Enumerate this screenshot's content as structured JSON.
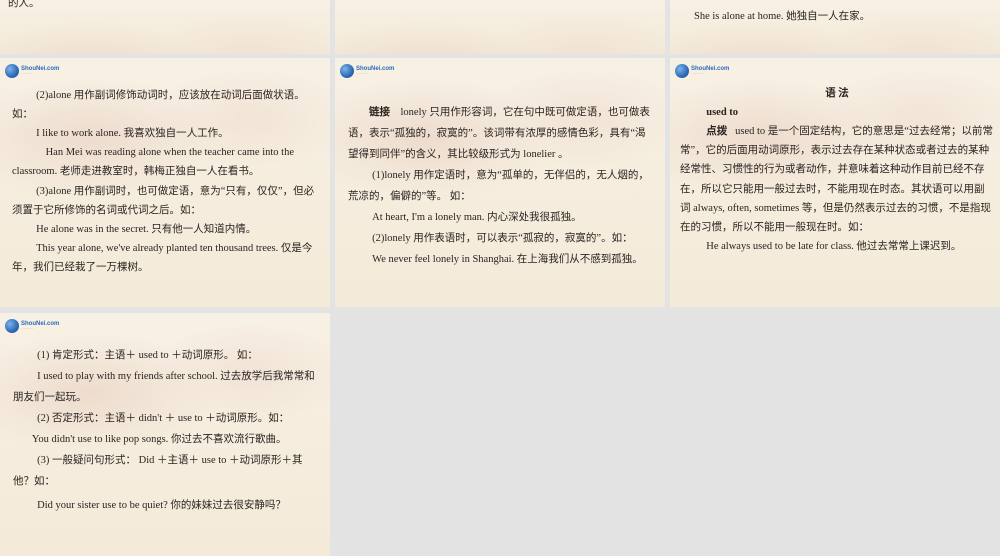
{
  "slide1": {
    "lines": [
      "的人。"
    ]
  },
  "slide3": {
    "lines": [
      "She is alone at home. 她独自一人在家。"
    ]
  },
  "slide4": {
    "lines": [
      "(2)alone  用作副词修饰动词时，应该放在动词后面做状语。如：",
      "I like to work alone. 我喜欢独自一人工作。",
      "Han Mei was reading alone when the teacher came into the classroom. 老师走进教室时，韩梅正独自一人在看书。",
      "(3)alone  用作副词时，也可做定语，意为“只有，仅仅”，但必须置于它所修饰的名词或代词之后。如：",
      "He alone was in the secret. 只有他一人知道内情。",
      "This year alone, we've already planted ten thousand trees. 仅是今年，我们已经栽了一万棵树。"
    ]
  },
  "slide5": {
    "label": "链接",
    "lines": [
      "lonely  只用作形容词，它在句中既可做定语，也可做表语，表示“孤独的，寂寞的”。该词带有浓厚的感情色彩，具有“渴望得到同伴”的含义，其比较级形式为   lonelier 。",
      "(1)lonely  用作定语时，意为“孤单的，无伴侣的，无人烟的，荒凉的，偏僻的”等。  如：",
      "At heart, I'm a lonely man. 内心深处我很孤独。",
      "(2)lonely  用作表语时，可以表示“孤寂的，寂寞的”。如：",
      "We never feel lonely in Shanghai. 在上海我们从不感到孤独。"
    ]
  },
  "slide6": {
    "title": "语  法",
    "subtitle": "used to",
    "label": "点拨",
    "lines": [
      "used to  是一个固定结构，它的意思是“过去经常；以前常常”，它的后面用动词原形，表示过去存在某种状态或者过去的某种经常性、习惯性的行为或者动作，并意味着这种动作目前已经不存在，所以它只能用一般过去时，不能用现在时态。其状语可以用副词   always, often, sometimes  等，但是仍然表示过去的习惯，不是指现在的习惯，所以不能用一般现在时。如：",
      "He always used to be late for class. 他过去常常上课迟到。"
    ]
  },
  "slide7": {
    "lines": [
      "(1) 肯定形式：主语＋ used to ＋动词原形。  如：",
      "I used to play with my friends after school.  过去放学后我常常和朋友们一起玩。",
      "(2) 否定形式：主语＋ didn't ＋ use to ＋动词原形。如：",
      "You didn't use to like pop songs. 你过去不喜欢流行歌曲。",
      "(3)  一般疑问句形式：  Did  ＋主语＋ use to ＋动词原形＋其他？如：",
      "Did your sister use to be quiet?   你的妹妹过去很安静吗？"
    ]
  }
}
